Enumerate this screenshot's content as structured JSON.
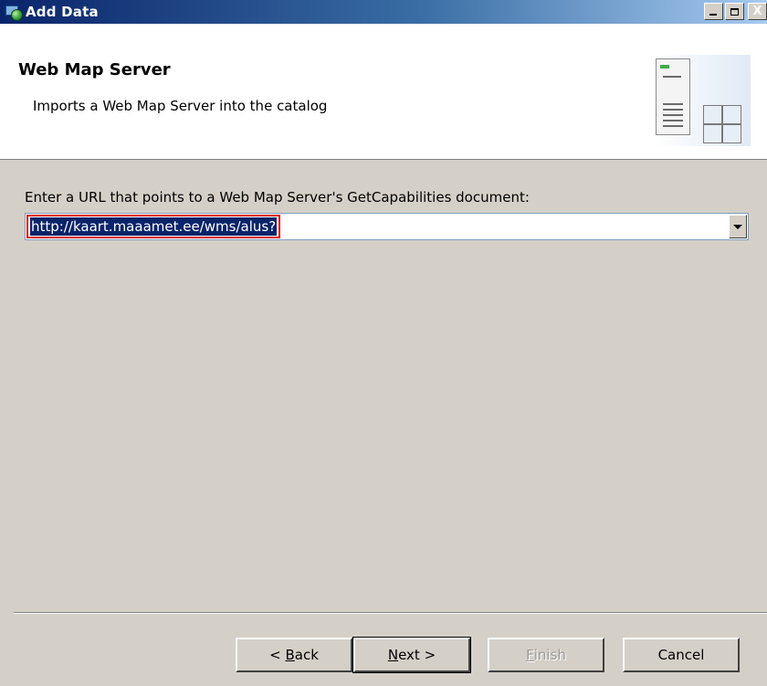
{
  "window": {
    "title": "Add Data",
    "icon": "add-data-icon",
    "controls": {
      "minimize": "minimize-icon",
      "maximize": "maximize-icon",
      "close": "close-icon",
      "close_glyph": "X"
    }
  },
  "banner": {
    "title": "Web Map Server",
    "description": "Imports a Web Map Server into the catalog",
    "image": "server-catalog-icon"
  },
  "form": {
    "prompt": "Enter a URL that points to a Web Map Server's GetCapabilities document:",
    "url_value": "http://kaart.maaamet.ee/wms/alus?",
    "url_selected": true,
    "highlight_color": "#e01010",
    "selection_color": "#0a246a"
  },
  "buttons": {
    "back": {
      "prefix": "< ",
      "mnemonic": "B",
      "rest": "ack",
      "enabled": true
    },
    "next": {
      "prefix": "",
      "mnemonic": "N",
      "rest": "ext >",
      "enabled": true,
      "default": true
    },
    "finish": {
      "prefix": "",
      "mnemonic": "F",
      "rest": "inish",
      "enabled": false
    },
    "cancel": {
      "label": "Cancel",
      "enabled": true
    }
  }
}
